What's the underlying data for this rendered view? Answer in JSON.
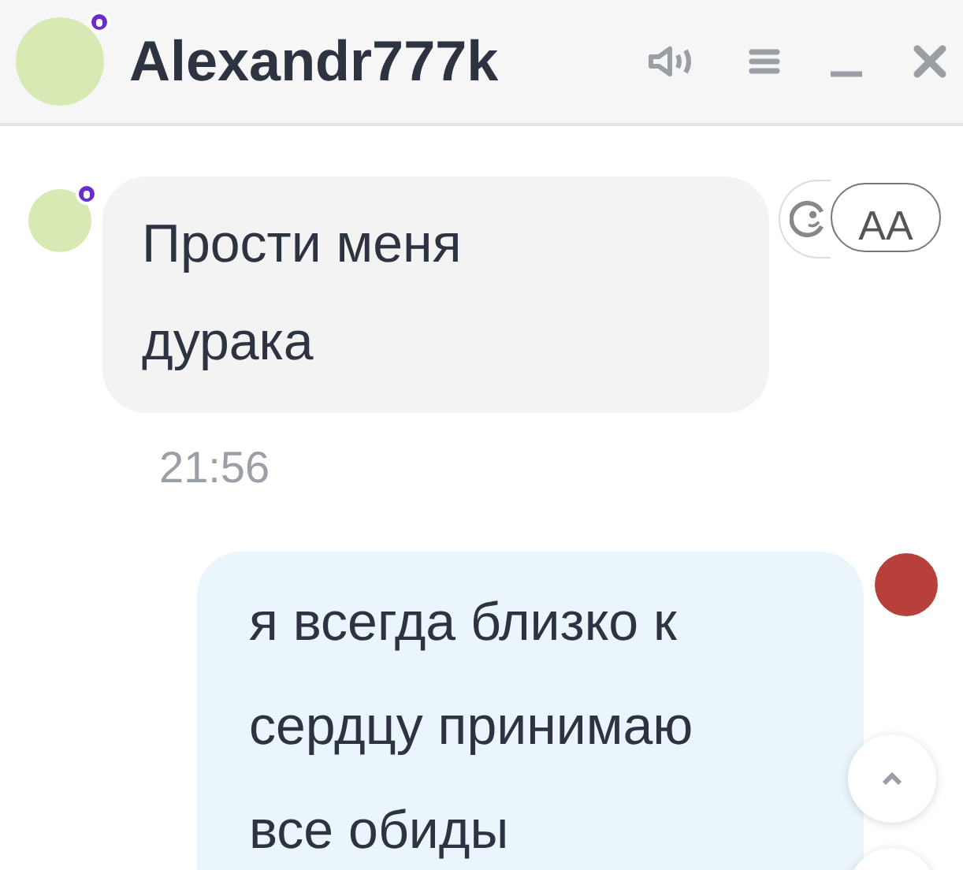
{
  "header": {
    "name": "Alexandr777k"
  },
  "messages": [
    {
      "kind": "incoming",
      "text": "Прости меня\nдурака",
      "time": "21:56",
      "reaction_label": "AA"
    },
    {
      "kind": "outgoing",
      "text": "я всегда близко к\nсердцу принимаю\nвсе обиды"
    }
  ]
}
